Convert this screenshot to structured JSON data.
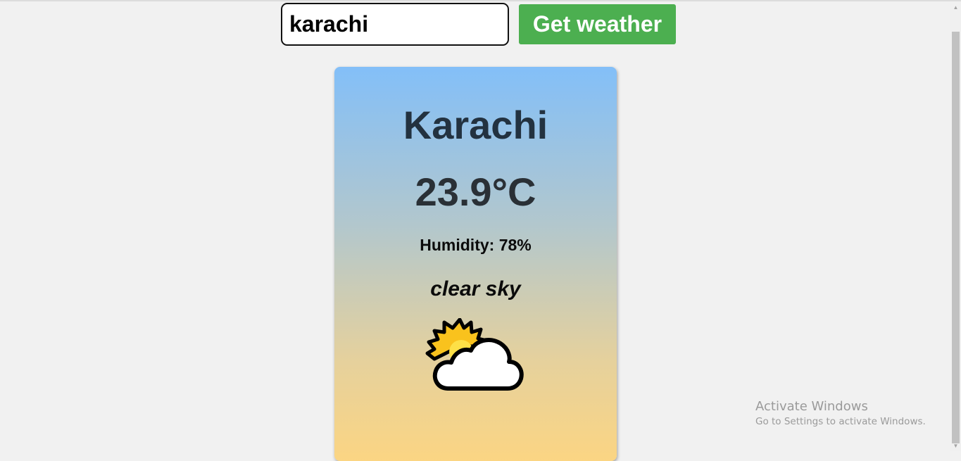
{
  "search": {
    "value": "karachi",
    "button_label": "Get weather",
    "button_color": "#4caf50"
  },
  "card": {
    "city": "Karachi",
    "temperature": "23.9°C",
    "humidity": "Humidity: 78%",
    "description": "clear sky",
    "icon": "sun-behind-cloud-icon",
    "gradient_top": "#83bff8",
    "gradient_bottom": "#fbd583"
  },
  "watermark": {
    "title": "Activate Windows",
    "subtitle": "Go to Settings to activate Windows."
  }
}
